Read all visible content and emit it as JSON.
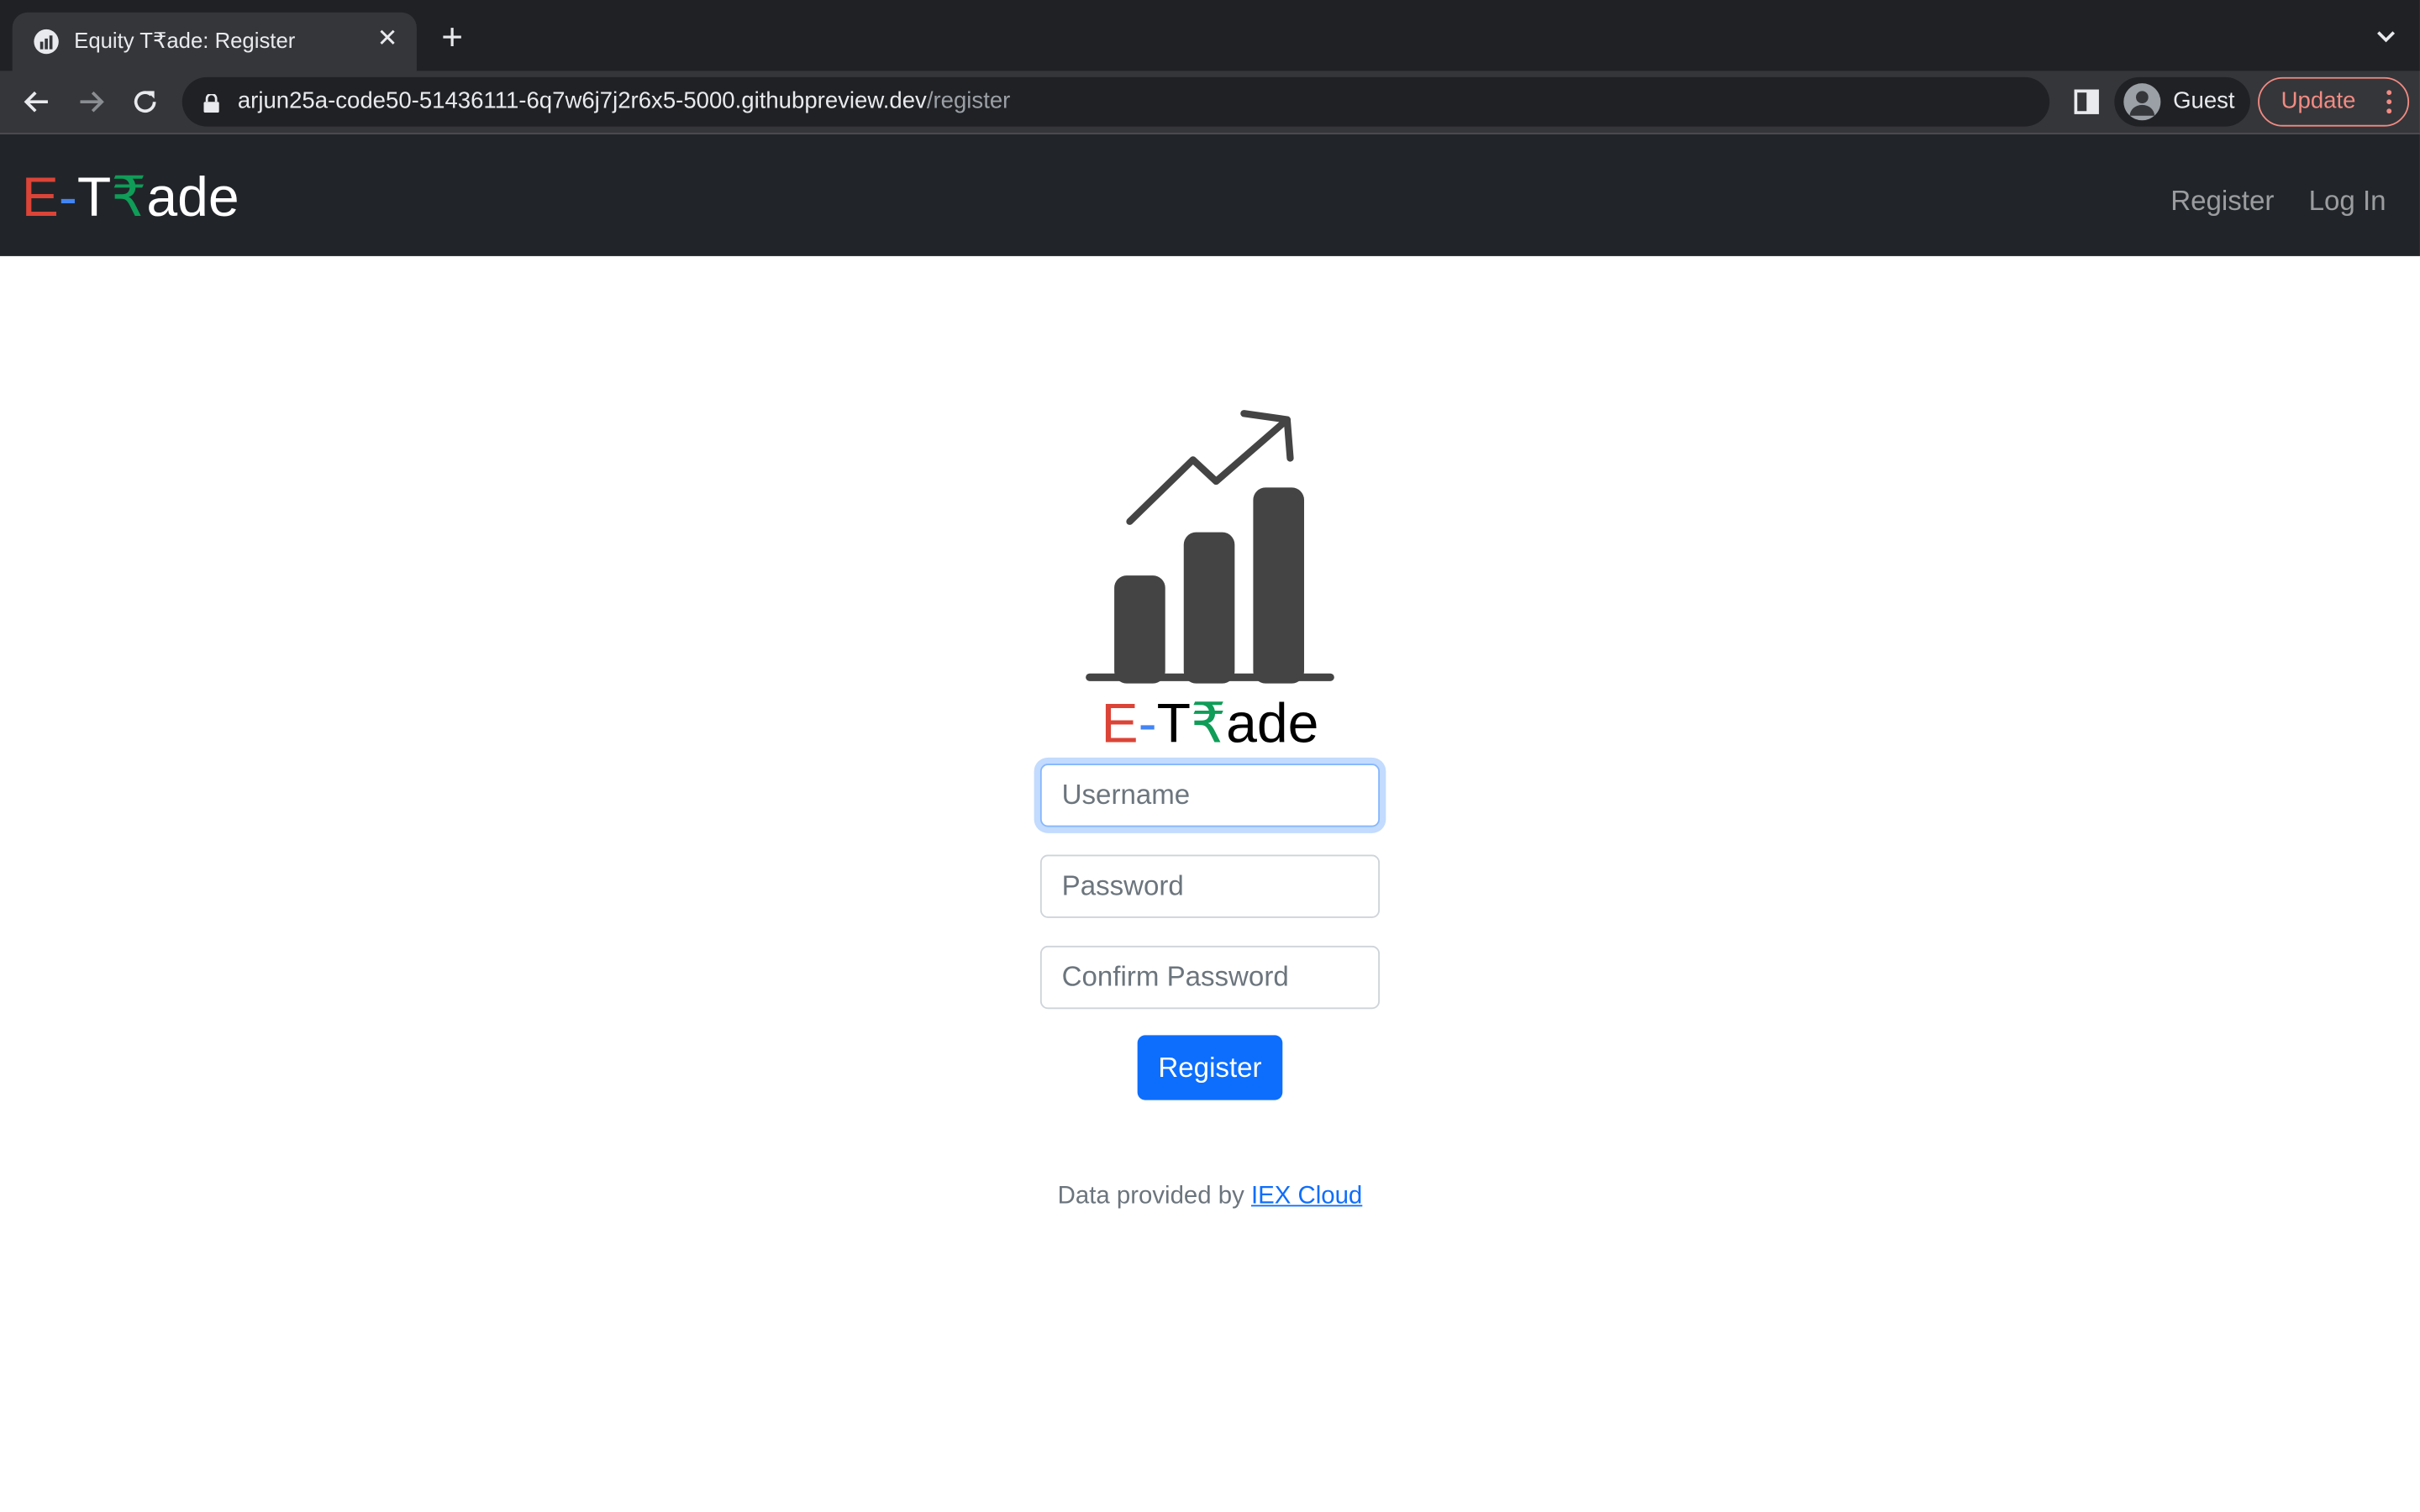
{
  "browser": {
    "tab": {
      "title": "Equity T₹ade: Register"
    },
    "url": {
      "host": "arjun25a-code50-51436111-6q7w6j7j2r6x5-5000.githubpreview.dev",
      "path": "/register"
    },
    "profile": {
      "label": "Guest"
    },
    "update_label": "Update"
  },
  "site": {
    "brand": {
      "part1": "E",
      "part2": "-",
      "part3": "T",
      "part4": "₹",
      "part5": "ade"
    },
    "nav": {
      "register": "Register",
      "login": "Log In"
    }
  },
  "form": {
    "username_placeholder": "Username",
    "password_placeholder": "Password",
    "confirm_placeholder": "Confirm Password",
    "submit_label": "Register"
  },
  "footer": {
    "prefix": "Data provided by ",
    "link": "IEX Cloud"
  },
  "colors": {
    "red": "#db4437",
    "blue": "#4285f4",
    "green": "#0f9d58",
    "primary": "#0d6efd",
    "navbar": "#212529"
  }
}
